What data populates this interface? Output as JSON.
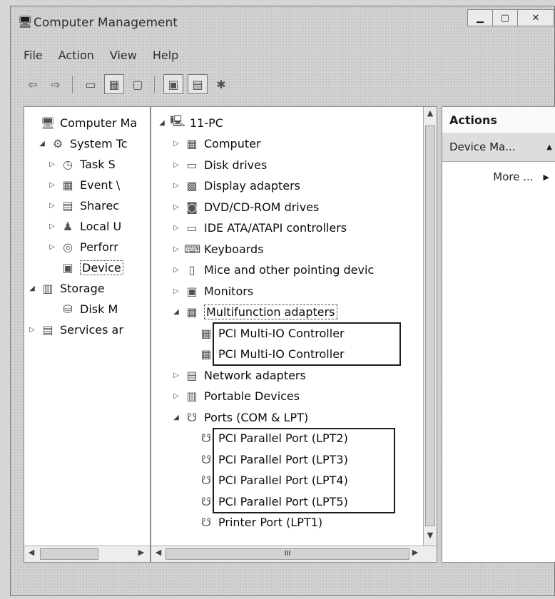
{
  "window": {
    "title": "Computer Management"
  },
  "menu": [
    {
      "label": "File",
      "name": "menu-file"
    },
    {
      "label": "Action",
      "name": "menu-action"
    },
    {
      "label": "View",
      "name": "menu-view"
    },
    {
      "label": "Help",
      "name": "menu-help"
    }
  ],
  "toolbar": {
    "icons": [
      "back-icon",
      "forward-icon",
      "up-icon",
      "show-hide-tree-icon",
      "properties-icon",
      "help-icon",
      "console-icon",
      "scan-hardware-icon"
    ]
  },
  "left_tree": [
    {
      "label": "Computer Ma",
      "indent": 0,
      "exp": "",
      "icon": "computer-management-icon",
      "glyph": "🖥"
    },
    {
      "label": "System Tc",
      "indent": 1,
      "exp": "◢",
      "icon": "system-tools-icon",
      "glyph": "⚙"
    },
    {
      "label": "Task S",
      "indent": 2,
      "exp": "▷",
      "icon": "task-scheduler-icon",
      "glyph": "◷"
    },
    {
      "label": "Event \\",
      "indent": 2,
      "exp": "▷",
      "icon": "event-viewer-icon",
      "glyph": "▦"
    },
    {
      "label": "Sharec",
      "indent": 2,
      "exp": "▷",
      "icon": "shared-folders-icon",
      "glyph": "▤"
    },
    {
      "label": "Local U",
      "indent": 2,
      "exp": "▷",
      "icon": "local-users-icon",
      "glyph": "♟"
    },
    {
      "label": "Perforr",
      "indent": 2,
      "exp": "▷",
      "icon": "performance-icon",
      "glyph": "◎"
    },
    {
      "label": "Device",
      "indent": 2,
      "exp": "",
      "icon": "device-manager-icon",
      "glyph": "▣",
      "selected": true
    },
    {
      "label": "Storage",
      "indent": 0,
      "exp": "◢",
      "icon": "storage-icon",
      "glyph": "▥"
    },
    {
      "label": "Disk M",
      "indent": 2,
      "exp": "",
      "icon": "disk-management-icon",
      "glyph": "⛁"
    },
    {
      "label": "Services ar",
      "indent": 0,
      "exp": "▷",
      "icon": "services-icon",
      "glyph": "▤"
    }
  ],
  "device_tree": [
    {
      "label": "11-PC",
      "indent": 0,
      "exp": "◢",
      "icon": "pc-icon",
      "glyph": "🖳"
    },
    {
      "label": "Computer",
      "indent": 1,
      "exp": "▷",
      "icon": "computer-icon",
      "glyph": "▦"
    },
    {
      "label": "Disk drives",
      "indent": 1,
      "exp": "▷",
      "icon": "disk-drive-icon",
      "glyph": "▭"
    },
    {
      "label": "Display adapters",
      "indent": 1,
      "exp": "▷",
      "icon": "display-adapter-icon",
      "glyph": "▩"
    },
    {
      "label": "DVD/CD-ROM drives",
      "indent": 1,
      "exp": "▷",
      "icon": "dvd-drive-icon",
      "glyph": "◙"
    },
    {
      "label": "IDE ATA/ATAPI controllers",
      "indent": 1,
      "exp": "▷",
      "icon": "ide-controller-icon",
      "glyph": "▭"
    },
    {
      "label": "Keyboards",
      "indent": 1,
      "exp": "▷",
      "icon": "keyboard-icon",
      "glyph": "⌨"
    },
    {
      "label": "Mice and other pointing devic",
      "indent": 1,
      "exp": "▷",
      "icon": "mouse-icon",
      "glyph": "▯"
    },
    {
      "label": "Monitors",
      "indent": 1,
      "exp": "▷",
      "icon": "monitor-icon",
      "glyph": "▣"
    },
    {
      "label": "Multifunction adapters",
      "indent": 1,
      "exp": "◢",
      "icon": "multifunction-adapter-icon",
      "glyph": "▦",
      "dashed": true
    },
    {
      "label": "PCI Multi-IO Controller",
      "indent": 2,
      "exp": "",
      "icon": "controller-icon",
      "glyph": "▦"
    },
    {
      "label": "PCI Multi-IO Controller",
      "indent": 2,
      "exp": "",
      "icon": "controller-icon",
      "glyph": "▦"
    },
    {
      "label": "Network adapters",
      "indent": 1,
      "exp": "▷",
      "icon": "network-adapter-icon",
      "glyph": "▤"
    },
    {
      "label": "Portable Devices",
      "indent": 1,
      "exp": "▷",
      "icon": "portable-device-icon",
      "glyph": "▥"
    },
    {
      "label": "Ports (COM & LPT)",
      "indent": 1,
      "exp": "◢",
      "icon": "ports-icon",
      "glyph": "☋"
    },
    {
      "label": "PCI Parallel Port (LPT2)",
      "indent": 2,
      "exp": "",
      "icon": "port-icon",
      "glyph": "☋"
    },
    {
      "label": "PCI Parallel Port (LPT3)",
      "indent": 2,
      "exp": "",
      "icon": "port-icon",
      "glyph": "☋"
    },
    {
      "label": "PCI Parallel Port (LPT4)",
      "indent": 2,
      "exp": "",
      "icon": "port-icon",
      "glyph": "☋"
    },
    {
      "label": "PCI Parallel Port (LPT5)",
      "indent": 2,
      "exp": "",
      "icon": "port-icon",
      "glyph": "☋"
    },
    {
      "label": "Printer Port (LPT1)",
      "indent": 2,
      "exp": "",
      "icon": "port-icon",
      "glyph": "☋"
    }
  ],
  "actions": {
    "header": "Actions",
    "section": "Device Ma...",
    "more": "More ..."
  },
  "scrollbar_glyph": "III"
}
